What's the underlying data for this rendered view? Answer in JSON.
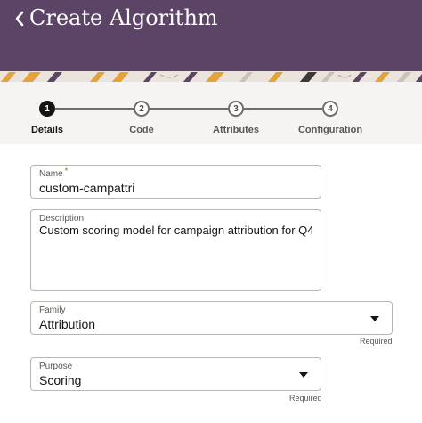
{
  "header": {
    "title": "Create Algorithm",
    "back_icon": "chevron-left-icon"
  },
  "train": {
    "steps": [
      {
        "number": "1",
        "label": "Details",
        "active": true
      },
      {
        "number": "2",
        "label": "Code",
        "active": false
      },
      {
        "number": "3",
        "label": "Attributes",
        "active": false
      },
      {
        "number": "4",
        "label": "Configuration",
        "active": false
      }
    ]
  },
  "form": {
    "name": {
      "label": "Name",
      "required_mark": "*",
      "value": "custom-campattri"
    },
    "description": {
      "label": "Description",
      "value": "Custom scoring model for campaign attribution for Q4"
    },
    "family": {
      "label": "Family",
      "value": "Attribution",
      "required_text": "Required"
    },
    "purpose": {
      "label": "Purpose",
      "value": "Scoring",
      "required_text": "Required"
    }
  },
  "colors": {
    "header": "#5b4466",
    "active_step": "#161513",
    "inactive_step": "#6f6c69"
  }
}
